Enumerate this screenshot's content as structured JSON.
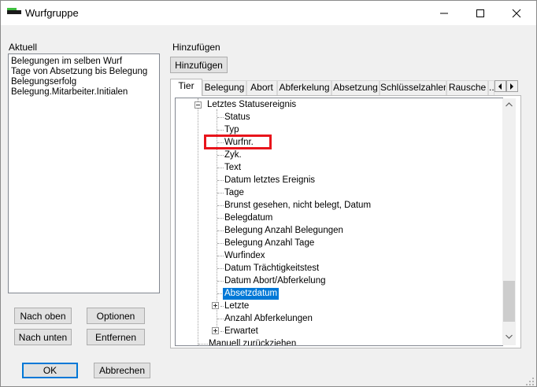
{
  "window": {
    "title": "Wurfgruppe",
    "controls": {
      "minimize": "minimize",
      "maximize": "maximize",
      "close": "close"
    }
  },
  "left_panel": {
    "label": "Aktuell",
    "items": [
      "Belegungen im selben Wurf",
      "Tage von Absetzung bis Belegung",
      "Belegungserfolg",
      "Belegung.Mitarbeiter.Initialen"
    ],
    "buttons": {
      "up": "Nach oben",
      "options": "Optionen",
      "down": "Nach unten",
      "remove": "Entfernen"
    }
  },
  "right_panel": {
    "label": "Hinzufügen",
    "add_button": "Hinzufügen",
    "tabs": [
      "Tier",
      "Belegung",
      "Abort",
      "Abferkelung",
      "Absetzung",
      "Schlüsselzahlen",
      "Rausche",
      "..."
    ],
    "active_tab": "Tier",
    "tree": {
      "parent": "Letztes Statusereignis",
      "children": [
        "Status",
        "Typ",
        "Wurfnr.",
        "Zyk.",
        "Text",
        "Datum letztes Ereignis",
        "Tage",
        "Brunst gesehen, nicht belegt, Datum",
        "Belegdatum",
        "Belegung Anzahl Belegungen",
        "Belegung Anzahl Tage",
        "Wurfindex",
        "Datum Trächtigkeitstest",
        "Datum Abort/Abferkelung",
        "Absetzdatum",
        "Letzte",
        "Anzahl Abferkelungen",
        "Erwartet"
      ],
      "selected": "Absetzdatum",
      "highlighted": "Wurfnr.",
      "next_root": "Manuell zurückziehen"
    }
  },
  "footer": {
    "ok": "OK",
    "cancel": "Abbrechen"
  },
  "colors": {
    "selection": "#0078d7",
    "highlight": "#e8141b"
  }
}
